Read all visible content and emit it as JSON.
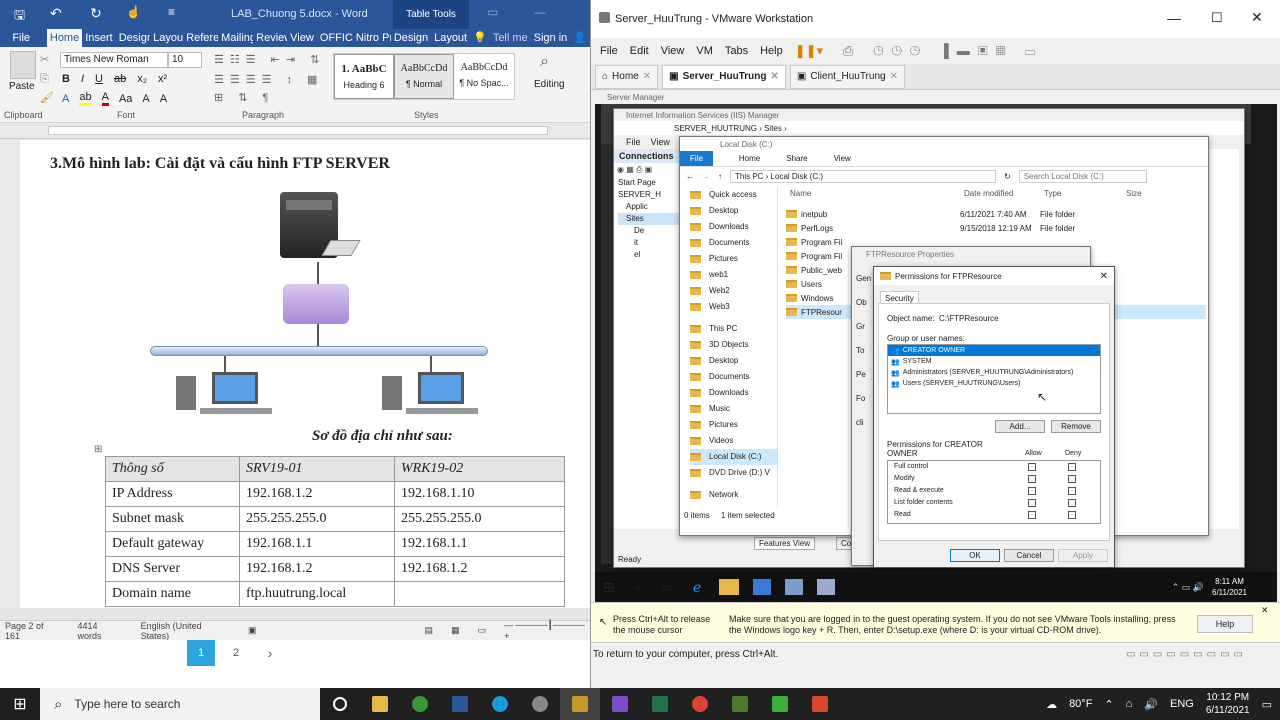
{
  "word": {
    "title": "LAB_Chuong 5.docx - Word",
    "table_tools": "Table Tools",
    "tabs": [
      "File",
      "Home",
      "Insert",
      "Design",
      "Layout",
      "References",
      "Mailings",
      "Review",
      "View",
      "OFFICE",
      "Nitro Pro",
      "Design",
      "Layout"
    ],
    "tell_me": "Tell me",
    "sign_in": "Sign in",
    "font_name": "Times New Roman",
    "font_size": "10",
    "paste": "Paste",
    "styles": [
      {
        "preview": "1.  AaBbC",
        "name": "Heading 6"
      },
      {
        "preview": "AaBbCcDd",
        "name": "¶ Normal"
      },
      {
        "preview": "AaBbCcDd",
        "name": "¶ No Spac..."
      }
    ],
    "editing": "Editing",
    "groups": {
      "clipboard": "Clipboard",
      "font": "Font",
      "paragraph": "Paragraph",
      "styles": "Styles"
    },
    "heading": "3.Mô hình lab: Cài đặt và cấu hình FTP SERVER",
    "subheading": "Sơ đồ địa chỉ như sau:",
    "table": [
      [
        "Thông số",
        "SRV19-01",
        "WRK19-02"
      ],
      [
        "IP Address",
        "192.168.1.2",
        "192.168.1.10"
      ],
      [
        "Subnet mask",
        "255.255.255.0",
        "255.255.255.0"
      ],
      [
        "Default gateway",
        "192.168.1.1",
        "192.168.1.1"
      ],
      [
        "DNS Server",
        "192.168.1.2",
        "192.168.1.2"
      ],
      [
        "Domain name",
        "ftp.huutrung.local",
        ""
      ]
    ],
    "status": {
      "page": "Page 2 of 161",
      "words": "4414 words",
      "lang": "English (United States)"
    },
    "pager": {
      "p1": "1",
      "p2": "2",
      "next": "›"
    }
  },
  "vmware": {
    "title": "Server_HuuTrung - VMware Workstation",
    "menu": [
      "File",
      "Edit",
      "View",
      "VM",
      "Tabs",
      "Help"
    ],
    "tabs": [
      "Home",
      "Server_HuuTrung",
      "Client_HuuTrung"
    ],
    "server_manager": "Server Manager",
    "iis_title": "Internet Information Services (IIS) Manager",
    "iis_path": "SERVER_HUUTRUNG  ›  Sites  ›",
    "iis_menu": [
      "File",
      "View"
    ],
    "connections": "Connections",
    "iis_tree": [
      "Start Page",
      "SERVER_H",
      "Applic",
      "Sites",
      "De",
      "it",
      "el"
    ],
    "features_view": "Features View",
    "content_tab": "Con",
    "ready": "Ready",
    "explorer": {
      "title": "Local Disk (C:)",
      "ribbon": [
        "File",
        "Home",
        "Share",
        "View"
      ],
      "breadcrumb": "This PC  ›  Local Disk (C:)",
      "search": "Search Local Disk (C:)",
      "nav": [
        "Quick access",
        "Desktop",
        "Downloads",
        "Documents",
        "Pictures",
        "web1",
        "Web2",
        "Web3",
        "This PC",
        "3D Objects",
        "Desktop",
        "Documents",
        "Downloads",
        "Music",
        "Pictures",
        "Videos",
        "Local Disk (C:)",
        "DVD Drive (D:) V",
        "Network"
      ],
      "cols": [
        "Name",
        "Date modified",
        "Type",
        "Size"
      ],
      "files": [
        {
          "name": "inetpub",
          "date": "6/11/2021 7:40 AM",
          "type": "File folder"
        },
        {
          "name": "PerfLogs",
          "date": "9/15/2018 12:19 AM",
          "type": "File folder"
        },
        {
          "name": "Program Fil",
          "date": "",
          "type": ""
        },
        {
          "name": "Program Fil",
          "date": "",
          "type": ""
        },
        {
          "name": "Public_web",
          "date": "",
          "type": ""
        },
        {
          "name": "Users",
          "date": "",
          "type": ""
        },
        {
          "name": "Windows",
          "date": "",
          "type": ""
        },
        {
          "name": "FTPResour",
          "date": "",
          "type": ""
        }
      ],
      "status": "0 items     1 item selected"
    },
    "props_title": "FTPResource Properties",
    "props_tabs": [
      "Gen",
      "Ob",
      "Gr",
      "To",
      "Pe",
      "Fo",
      "cli"
    ],
    "perm": {
      "title": "Permissions for FTPResource",
      "tab": "Security",
      "object_label": "Object name:",
      "object_value": "C:\\FTPResource",
      "group_label": "Group or user names:",
      "users": [
        "CREATOR OWNER",
        "SYSTEM",
        "Administrators (SERVER_HUUTRUNG\\Administrators)",
        "Users (SERVER_HUUTRUNG\\Users)"
      ],
      "add": "Add...",
      "remove": "Remove",
      "perms_for": "Permissions for CREATOR OWNER",
      "allow": "Allow",
      "deny": "Deny",
      "perms": [
        "Full control",
        "Modify",
        "Read & execute",
        "List folder contents",
        "Read"
      ],
      "ok": "OK",
      "cancel": "Cancel",
      "apply": "Apply"
    },
    "guest_time": "8:11 AM",
    "guest_date": "6/11/2021",
    "note_left": "Press Ctrl+Alt to release the mouse cursor",
    "note_main": "Make sure that you are logged in to the guest operating system. If you do not see VMware Tools installing, press the Windows logo key + R. Then, enter D:\\setup.exe (where D: is your virtual CD-ROM drive).",
    "help": "Help",
    "status": "To return to your computer, press Ctrl+Alt."
  },
  "taskbar": {
    "search": "Type here to search",
    "temp": "80°F",
    "lang": "ENG",
    "time": "10:12 PM",
    "date": "6/11/2021"
  },
  "colors": {
    "word_blue": "#2b579a",
    "selection": "#0078d7",
    "taskbar": "#202020"
  }
}
